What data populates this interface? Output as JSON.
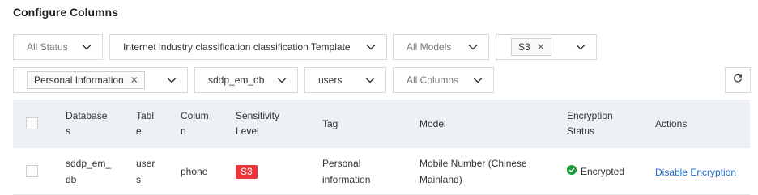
{
  "title": "Configure Columns",
  "filters": {
    "status": "All Status",
    "template": "Internet industry classification classification Template",
    "models": "All Models",
    "level_tag": "S3",
    "category_tag": "Personal Information",
    "database": "sddp_em_db",
    "table": "users",
    "columns": "All Columns"
  },
  "table": {
    "headers": {
      "database": [
        "Database",
        "s"
      ],
      "table": [
        "Tabl",
        "e"
      ],
      "column": [
        "Colum",
        "n"
      ],
      "sensitivity": [
        "Sensitivity",
        "Level"
      ],
      "tag": "Tag",
      "model": "Model",
      "encryption": [
        "Encryption",
        "Status"
      ],
      "actions": "Actions"
    },
    "rows": [
      {
        "database": [
          "sddp_em_",
          "db"
        ],
        "table": [
          "user",
          "s"
        ],
        "column": "phone",
        "sensitivity": "S3",
        "tag": [
          "Personal",
          "information"
        ],
        "model": [
          "Mobile Number (Chinese",
          "Mainland)"
        ],
        "encryption": "Encrypted",
        "action": "Disable Encryption"
      }
    ]
  },
  "colors": {
    "accent": "#1968c7",
    "danger": "#e8363a",
    "success": "#1a9e3a",
    "header_bg": "#edf0f5"
  },
  "icons": {
    "dropdown": "chevron-down-icon",
    "remove": "close-icon",
    "refresh": "refresh-icon",
    "status": "check-circle-icon"
  }
}
